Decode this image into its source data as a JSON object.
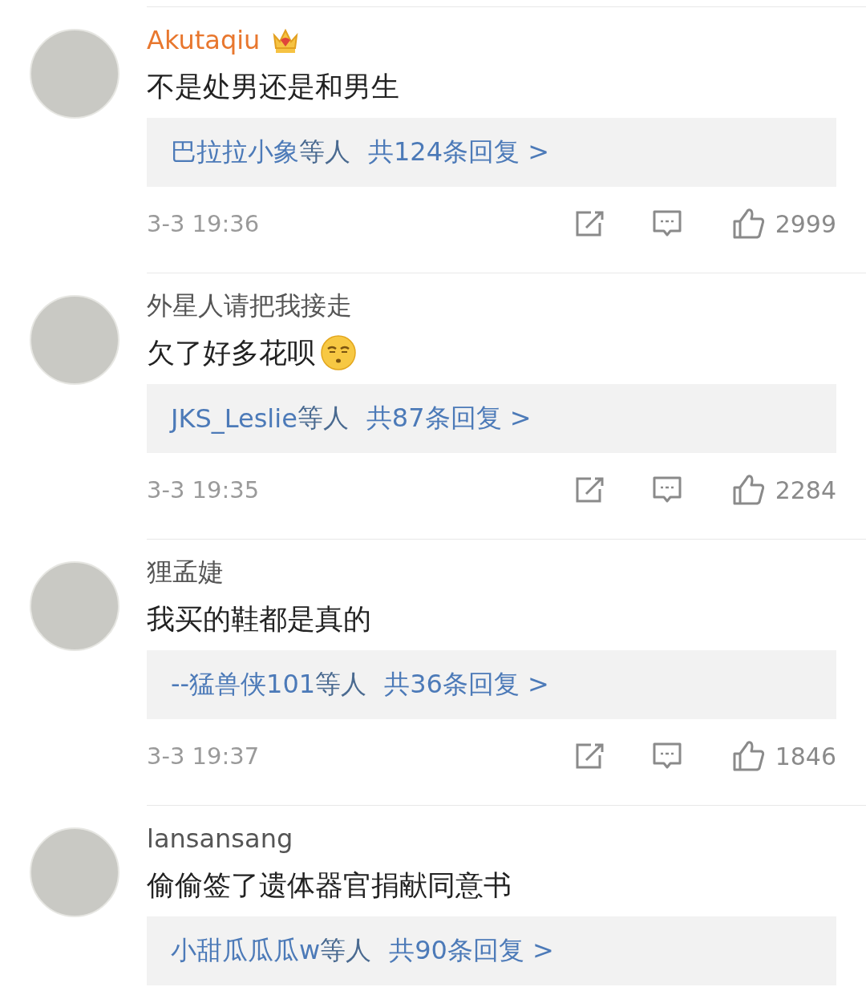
{
  "comments": [
    {
      "username": "Akutaqiu",
      "vip": true,
      "text": "不是处男还是和男生",
      "emoji": false,
      "reply_users": "巴拉拉小象",
      "reply_suffix": "等人",
      "reply_total": "共124条回复 >",
      "time": "3-3 19:36",
      "likes": "2999"
    },
    {
      "username": "外星人请把我接走",
      "vip": false,
      "text": "欠了好多花呗",
      "emoji": true,
      "reply_users": "JKS_Leslie",
      "reply_suffix": "等人",
      "reply_total": "共87条回复 >",
      "time": "3-3 19:35",
      "likes": "2284"
    },
    {
      "username": "狸孟婕",
      "vip": false,
      "text": "我买的鞋都是真的",
      "emoji": false,
      "reply_users": "--猛兽侠101",
      "reply_suffix": "等人",
      "reply_total": "共36条回复 >",
      "time": "3-3 19:37",
      "likes": "1846"
    },
    {
      "username": "lansansang",
      "vip": false,
      "text": "偷偷签了遗体器官捐献同意书",
      "emoji": false,
      "reply_users": "小甜瓜瓜瓜w",
      "reply_suffix": "等人",
      "reply_total": "共90条回复 >"
    }
  ]
}
